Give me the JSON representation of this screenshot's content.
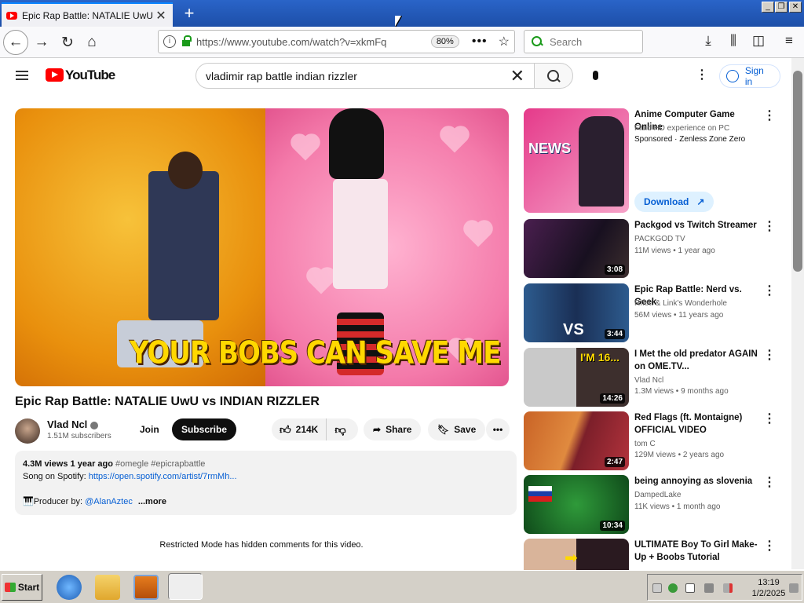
{
  "browser": {
    "tab_title": "Epic Rap Battle: NATALIE UwU vs",
    "url": "https://www.youtube.com/watch?v=xkmFq",
    "zoom": "80%",
    "search_placeholder": "Search"
  },
  "youtube": {
    "logo_text": "YouTube",
    "search_query": "vladimir rap battle indian rizzler",
    "sign_in": "Sign in",
    "video": {
      "caption": "YOUR BOBS CAN SAVE ME",
      "title": "Epic Rap Battle: NATALIE UwU vs INDIAN RIZZLER",
      "channel": "Vlad Ncl",
      "subscribers": "1.51M subscribers",
      "join": "Join",
      "subscribe": "Subscribe",
      "likes": "214K",
      "share": "Share",
      "save": "Save"
    },
    "description": {
      "views": "4.3M views",
      "age": "1 year ago",
      "tags": "#omegle #epicrapbattle",
      "line2_prefix": "Song on Spotify:",
      "line2_link": "https://open.spotify.com/artist/7rmMh...",
      "line3_prefix": "🎹Producer by:",
      "line3_link": "@AlanAztec",
      "more": "...more"
    },
    "restricted_note": "Restricted Mode has hidden comments for this video.",
    "sidebar": [
      {
        "title": "Anime Computer Game Online",
        "channel": "Fluid HD experience on PC",
        "meta": "Sponsored · Zenless Zone Zero",
        "sponsored": true,
        "cta": "Download"
      },
      {
        "title": "Packgod vs Twitch Streamer",
        "channel": "PACKGOD TV",
        "meta": "11M views • 1 year ago",
        "duration": "3:08"
      },
      {
        "title": "Epic Rap Battle: Nerd vs. Geek",
        "channel": "Rhett & Link's Wonderhole",
        "meta": "56M views • 11 years ago",
        "duration": "3:44"
      },
      {
        "title": "I Met the old predator AGAIN on OME.TV...",
        "channel": "Vlad Ncl",
        "meta": "1.3M views • 9 months ago",
        "duration": "14:26"
      },
      {
        "title": "Red Flags (ft. Montaigne) OFFICIAL VIDEO",
        "channel": "tom C",
        "meta": "129M views • 2 years ago",
        "duration": "2:47"
      },
      {
        "title": "being annoying as slovenia",
        "channel": "DampedLake",
        "meta": "11K views • 1 month ago",
        "duration": "10:34"
      },
      {
        "title": "ULTIMATE Boy To Girl Make-Up + Boobs Tutorial",
        "channel": "",
        "meta": ""
      }
    ]
  },
  "taskbar": {
    "start": "Start",
    "time": "13:19",
    "date": "1/2/2025"
  }
}
